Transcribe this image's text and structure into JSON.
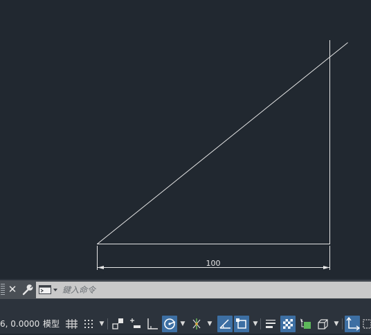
{
  "drawing": {
    "dimension_text": "100",
    "line_color": "#e6e6e6",
    "background_color": "#212830"
  },
  "command_line": {
    "placeholder": "鍵入命令",
    "close_glyph": "✕"
  },
  "status_bar": {
    "coordinates": "6, 0.0000",
    "model_label": "模型",
    "active_color": "#3d6fa3"
  }
}
